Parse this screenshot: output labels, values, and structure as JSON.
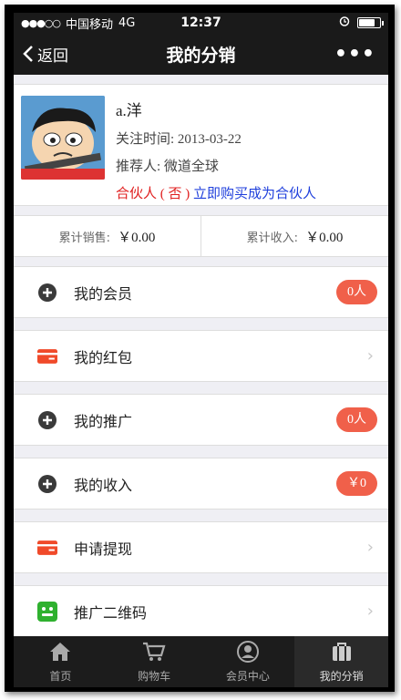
{
  "status": {
    "carrier": "中国移动",
    "network": "4G",
    "time": "12:37",
    "battery_level": 0.8
  },
  "navbar": {
    "back_label": "返回",
    "title": "我的分销",
    "more_label": "•••"
  },
  "profile": {
    "name": "a.洋",
    "follow_label": "关注时间:",
    "follow_date": "2013-03-22",
    "referrer_label": "推荐人:",
    "referrer": "微道全球",
    "partner_status": "合伙人 ( 否 )",
    "partner_cta": "立即购买成为合伙人"
  },
  "stats": [
    {
      "label": "累计销售:",
      "value": "￥0.00"
    },
    {
      "label": "累计收入:",
      "value": "￥0.00"
    }
  ],
  "menu": [
    {
      "label": "我的会员",
      "icon": "plus-circle-icon",
      "badge": "0人"
    },
    {
      "label": "我的红包",
      "icon": "card-icon",
      "badge": ""
    },
    {
      "label": "我的推广",
      "icon": "plus-circle-icon",
      "badge": "0人"
    },
    {
      "label": "我的收入",
      "icon": "plus-circle-icon",
      "badge": "￥0"
    },
    {
      "label": "申请提现",
      "icon": "card-icon",
      "badge": ""
    },
    {
      "label": "推广二维码",
      "icon": "qr-face-icon",
      "badge": ""
    }
  ],
  "tabs": [
    {
      "label": "首页",
      "icon": "home-icon"
    },
    {
      "label": "购物车",
      "icon": "cart-icon"
    },
    {
      "label": "会员中心",
      "icon": "user-icon"
    },
    {
      "label": "我的分销",
      "icon": "bag-icon"
    }
  ],
  "colors": {
    "badge": "#f0604a",
    "partner_red": "#e02020",
    "partner_blue": "#1f3fdc",
    "bar": "#1a1a1a"
  }
}
